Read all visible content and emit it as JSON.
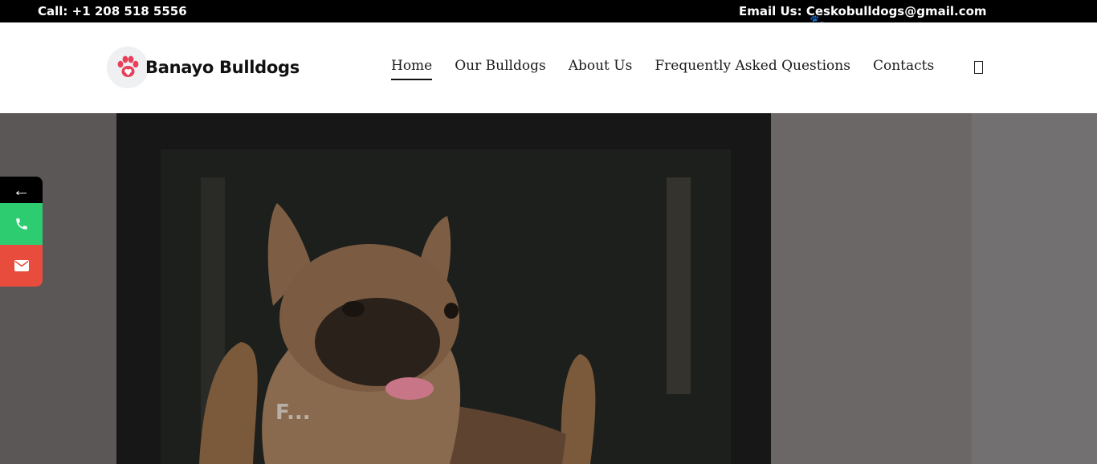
{
  "topbar": {
    "call": "Call: +1 208 518 5556",
    "email": "Email Us: Ceskobulldogs@gmail.com"
  },
  "brand": {
    "name": "Banayo Bulldogs",
    "logo_icon": "paw-heart-icon",
    "accent": "#e8405a"
  },
  "nav": {
    "items": [
      {
        "label": "Home",
        "active": true
      },
      {
        "label": "Our Bulldogs"
      },
      {
        "label": "About Us"
      },
      {
        "label": "Frequently Asked Questions"
      },
      {
        "label": "Contacts"
      }
    ]
  },
  "side_widget": {
    "toggle_icon": "←",
    "phone_color": "#2ecc71",
    "mail_color": "#e74c3c"
  },
  "hero": {
    "partial_text": "F..."
  }
}
